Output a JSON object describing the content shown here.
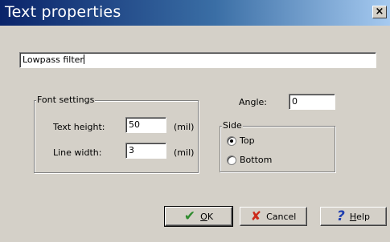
{
  "window": {
    "title": "Text properties",
    "close_glyph": "×"
  },
  "text_field": {
    "value": "Lowpass filter"
  },
  "font_settings": {
    "legend": "Font settings",
    "text_height_label": "Text height:",
    "text_height_value": "50",
    "text_height_unit": "(mil)",
    "line_width_label": "Line width:",
    "line_width_value": "3",
    "line_width_unit": "(mil)"
  },
  "angle": {
    "label": "Angle:",
    "value": "0"
  },
  "side": {
    "legend": "Side",
    "options": [
      {
        "label": "Top",
        "selected": true
      },
      {
        "label": "Bottom",
        "selected": false
      }
    ]
  },
  "buttons": {
    "ok": {
      "icon": "check-icon",
      "label_first": "O",
      "label_rest": "K"
    },
    "cancel": {
      "icon": "x-icon",
      "label": "Cancel"
    },
    "help": {
      "icon": "question-icon",
      "label_first": "H",
      "label_rest": "elp"
    }
  },
  "colors": {
    "title_bar_start": "#0a246a",
    "title_bar_end": "#a6caf0",
    "dialog_face": "#d4d0c8",
    "ok_icon": "#2e8b2e",
    "cancel_icon": "#cc2a1a",
    "help_icon": "#1f3fb0"
  }
}
